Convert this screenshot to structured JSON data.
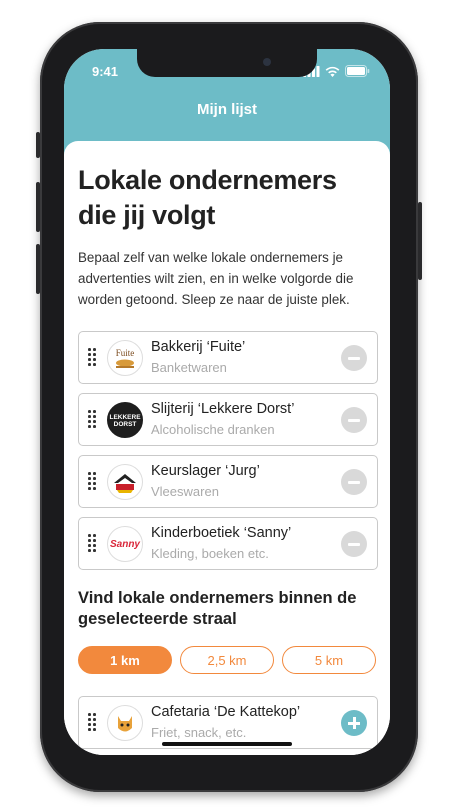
{
  "status": {
    "time": "9:41"
  },
  "nav": {
    "title": "Mijn lijst"
  },
  "headline": "Lokale ondernemers die jij volgt",
  "intro": "Bepaal zelf van welke lokale ondernemers je advertenties wilt zien, en in welke volgorde die worden getoond. Sleep ze naar de juiste plek.",
  "followed": [
    {
      "name": "Bakkerij ‘Fuite’",
      "category": "Banketwaren",
      "logo": "fuite-logo"
    },
    {
      "name": "Slijterij ‘Lekkere Dorst’",
      "category": "Alcoholische dranken",
      "logo": "lekkere-dorst-logo"
    },
    {
      "name": "Keurslager ‘Jurg’",
      "category": "Vleeswaren",
      "logo": "keurslager-logo"
    },
    {
      "name": "Kinderboetiek ‘Sanny’",
      "category": "Kleding, boeken etc.",
      "logo": "sanny-logo"
    }
  ],
  "discover": {
    "title": "Vind lokale ondernemers binnen de geselecteerde straal",
    "radius_options": [
      "1 km",
      "2,5 km",
      "5 km"
    ],
    "selected_radius": "1 km",
    "results": [
      {
        "name": "Cafetaria ‘De Kattekop’",
        "category": "Friet, snack, etc.",
        "logo": "kattekop-logo"
      }
    ]
  },
  "colors": {
    "accent": "#6dbcc7",
    "orange": "#f2893d"
  }
}
